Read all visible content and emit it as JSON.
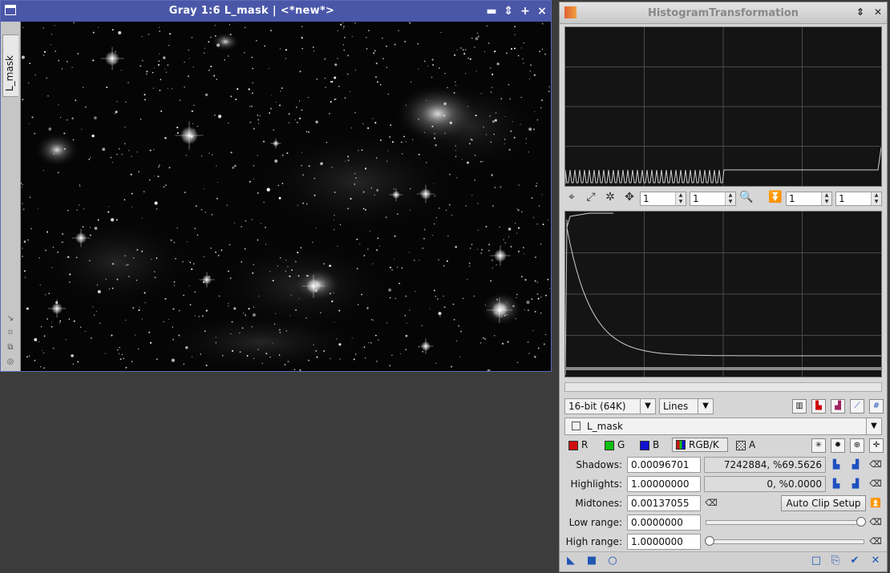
{
  "image_window": {
    "title": "Gray 1:6 L_mask | <*new*>",
    "side_tab": "L_mask",
    "buttons": {
      "minimize": "▬",
      "shade": "⇕",
      "maximize": "+",
      "close": "×"
    }
  },
  "histogram": {
    "title": "HistogramTransformation",
    "toolbar": {
      "zoom_h_left": "1",
      "zoom_v_left": "1",
      "zoom_h_right": "1",
      "zoom_v_right": "1"
    },
    "resolution": "16-bit (64K)",
    "graph_style": "Lines",
    "view": "L_mask",
    "channels": {
      "r": "R",
      "g": "G",
      "b": "B",
      "rgbk": "RGB/K",
      "a": "A"
    },
    "shadows_label": "Shadows:",
    "shadows_value": "0.00096701",
    "shadows_stats": "7242884, %69.5626",
    "highlights_label": "Highlights:",
    "highlights_value": "1.00000000",
    "highlights_stats": "0, %0.0000",
    "midtones_label": "Midtones:",
    "midtones_value": "0.00137055",
    "auto_clip_label": "Auto Clip Setup",
    "low_range_label": "Low range:",
    "low_range_value": "0.0000000",
    "high_range_label": "High range:",
    "high_range_value": "1.0000000",
    "colors": {
      "r": "#d01010",
      "g": "#10c010",
      "b": "#1010d0"
    }
  }
}
